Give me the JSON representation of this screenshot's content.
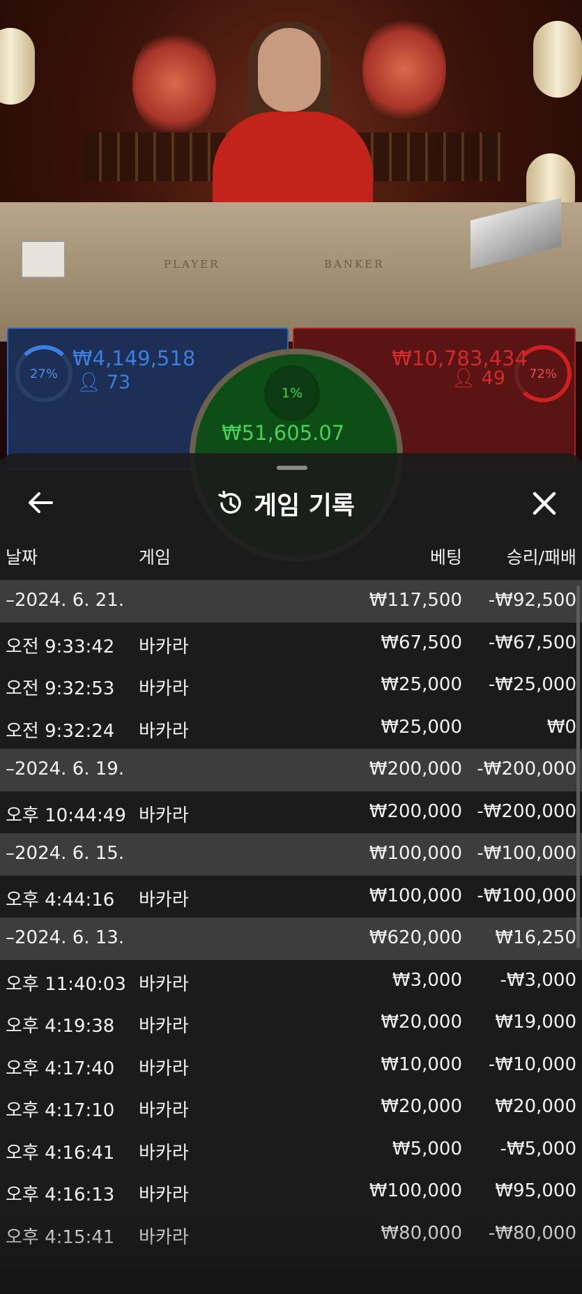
{
  "video": {
    "felt_labels": [
      "PLAYER",
      "BANKER"
    ]
  },
  "bets": {
    "player": {
      "percent": "27%",
      "amount": "₩4,149,518",
      "count": "73",
      "color": "#3c7fe0"
    },
    "banker": {
      "percent": "72%",
      "amount": "₩10,783,434",
      "count": "49",
      "color": "#d32a2a"
    },
    "tie": {
      "percent": "1%",
      "amount": "₩51,605.07",
      "color": "#42d25a"
    }
  },
  "history": {
    "title": "게임 기록",
    "columns": {
      "date": "날짜",
      "game": "게임",
      "bet": "베팅",
      "result": "승리/패배"
    },
    "rows": [
      {
        "type": "date",
        "date": "–2024. 6. 21.",
        "game": "",
        "bet": "₩117,500",
        "result": "-₩92,500"
      },
      {
        "type": "entry",
        "date": "오전 9:33:42",
        "game": "바카라",
        "bet": "₩67,500",
        "result": "-₩67,500"
      },
      {
        "type": "entry",
        "date": "오전 9:32:53",
        "game": "바카라",
        "bet": "₩25,000",
        "result": "-₩25,000"
      },
      {
        "type": "entry",
        "date": "오전 9:32:24",
        "game": "바카라",
        "bet": "₩25,000",
        "result": "₩0"
      },
      {
        "type": "date",
        "date": "–2024. 6. 19.",
        "game": "",
        "bet": "₩200,000",
        "result": "-₩200,000"
      },
      {
        "type": "entry",
        "date": "오후 10:44:49",
        "game": "바카라",
        "bet": "₩200,000",
        "result": "-₩200,000"
      },
      {
        "type": "date",
        "date": "–2024. 6. 15.",
        "game": "",
        "bet": "₩100,000",
        "result": "-₩100,000"
      },
      {
        "type": "entry",
        "date": "오후 4:44:16",
        "game": "바카라",
        "bet": "₩100,000",
        "result": "-₩100,000"
      },
      {
        "type": "date",
        "date": "–2024. 6. 13.",
        "game": "",
        "bet": "₩620,000",
        "result": "₩16,250"
      },
      {
        "type": "entry",
        "date": "오후 11:40:03",
        "game": "바카라",
        "bet": "₩3,000",
        "result": "-₩3,000"
      },
      {
        "type": "entry",
        "date": "오후 4:19:38",
        "game": "바카라",
        "bet": "₩20,000",
        "result": "₩19,000"
      },
      {
        "type": "entry",
        "date": "오후 4:17:40",
        "game": "바카라",
        "bet": "₩10,000",
        "result": "-₩10,000"
      },
      {
        "type": "entry",
        "date": "오후 4:17:10",
        "game": "바카라",
        "bet": "₩20,000",
        "result": "₩20,000"
      },
      {
        "type": "entry",
        "date": "오후 4:16:41",
        "game": "바카라",
        "bet": "₩5,000",
        "result": "-₩5,000"
      },
      {
        "type": "entry",
        "date": "오후 4:16:13",
        "game": "바카라",
        "bet": "₩100,000",
        "result": "₩95,000"
      },
      {
        "type": "entry",
        "date": "오후 4:15:41",
        "game": "바카라",
        "bet": "₩80,000",
        "result": "-₩80,000"
      }
    ]
  },
  "icons": {
    "back": "arrow-left-icon",
    "history": "history-icon",
    "close": "close-icon",
    "person": "person-icon"
  }
}
